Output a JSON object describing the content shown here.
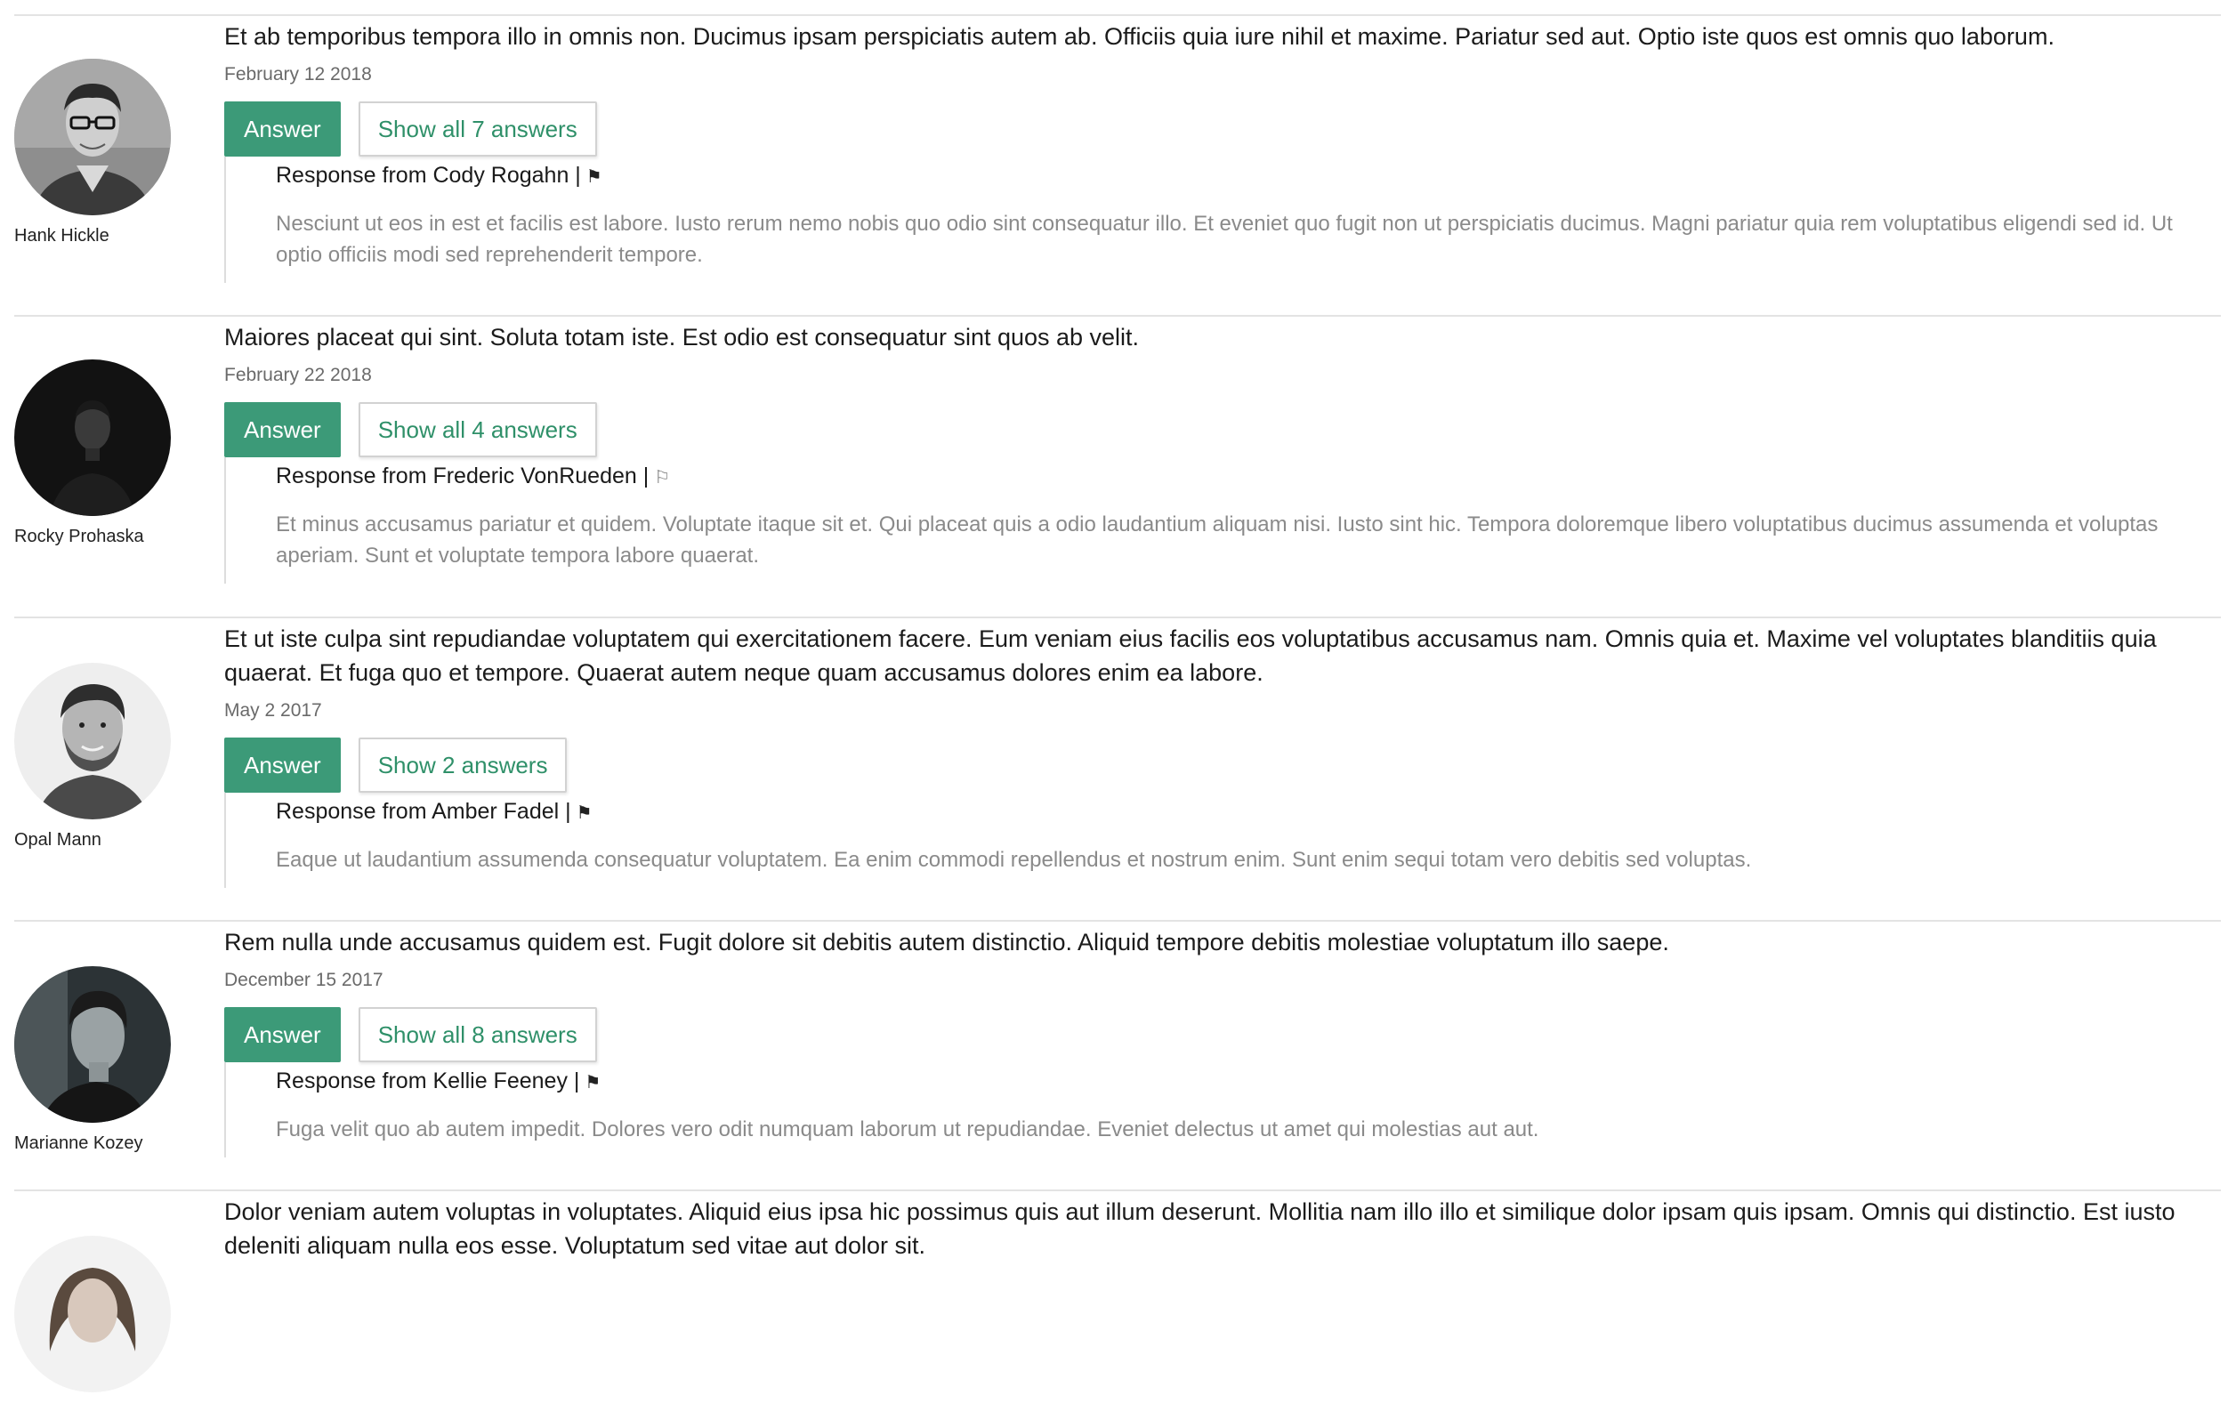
{
  "questions": [
    {
      "author": "Hank Hickle",
      "avatar_icon": "person-glasses-avatar",
      "text": "Et ab temporibus tempora illo in omnis non. Ducimus ipsam perspiciatis autem ab. Officiis quia iure nihil et maxime. Pariatur sed aut. Optio iste quos est omnis quo laborum.",
      "date": "February 12 2018",
      "answer_label": "Answer",
      "show_label": "Show all 7 answers",
      "response": {
        "prefix": "Response from Cody Rogahn |",
        "flag_icon": "flag-filled-icon",
        "text": "Nesciunt ut eos in est et facilis est labore. Iusto rerum nemo nobis quo odio sint consequatur illo. Et eveniet quo fugit non ut perspiciatis ducimus. Magni pariatur quia rem voluptatibus eligendi sed id. Ut optio officiis modi sed reprehenderit tempore."
      }
    },
    {
      "author": "Rocky Prohaska",
      "avatar_icon": "person-dark-avatar",
      "text": "Maiores placeat qui sint. Soluta totam iste. Est odio est consequatur sint quos ab velit.",
      "date": "February 22 2018",
      "answer_label": "Answer",
      "show_label": "Show all 4 answers",
      "response": {
        "prefix": "Response from Frederic VonRueden |",
        "flag_icon": "flag-outline-icon",
        "text": "Et minus accusamus pariatur et quidem. Voluptate itaque sit et. Qui placeat quis a odio laudantium aliquam nisi. Iusto sint hic. Tempora doloremque libero voluptatibus ducimus assumenda et voluptas aperiam. Sunt et voluptate tempora labore quaerat."
      }
    },
    {
      "author": "Opal Mann",
      "avatar_icon": "person-beard-avatar",
      "text": "Et ut iste culpa sint repudiandae voluptatem qui exercitationem facere. Eum veniam eius facilis eos voluptatibus accusamus nam. Omnis quia et. Maxime vel voluptates blanditiis quia quaerat. Et fuga quo et tempore. Quaerat autem neque quam accusamus dolores enim ea labore.",
      "date": "May 2 2017",
      "answer_label": "Answer",
      "show_label": "Show 2 answers",
      "response": {
        "prefix": "Response from Amber Fadel |",
        "flag_icon": "flag-filled-icon",
        "text": "Eaque ut laudantium assumenda consequatur voluptatem. Ea enim commodi repellendus et nostrum enim. Sunt enim sequi totam vero debitis sed voluptas."
      }
    },
    {
      "author": "Marianne Kozey",
      "avatar_icon": "person-profile-avatar",
      "text": "Rem nulla unde accusamus quidem est. Fugit dolore sit debitis autem distinctio. Aliquid tempore debitis molestiae voluptatum illo saepe.",
      "date": "December 15 2017",
      "answer_label": "Answer",
      "show_label": "Show all 8 answers",
      "response": {
        "prefix": "Response from Kellie Feeney |",
        "flag_icon": "flag-filled-icon",
        "text": "Fuga velit quo ab autem impedit. Dolores vero odit numquam laborum ut repudiandae. Eveniet delectus ut amet qui molestias aut aut."
      }
    },
    {
      "author": "",
      "avatar_icon": "person-long-hair-avatar",
      "text": "Dolor veniam autem voluptas in voluptates. Aliquid eius ipsa hic possimus quis aut illum deserunt. Mollitia nam illo illo et similique dolor ipsam quis ipsam. Omnis qui distinctio. Est iusto deleniti aliquam nulla eos esse. Voluptatum sed vitae aut dolor sit."
    }
  ],
  "colors": {
    "accent": "#3c9a78",
    "accent_text": "#2f9069",
    "divider": "#e3e3e3",
    "muted_text": "#8a8a8a"
  }
}
